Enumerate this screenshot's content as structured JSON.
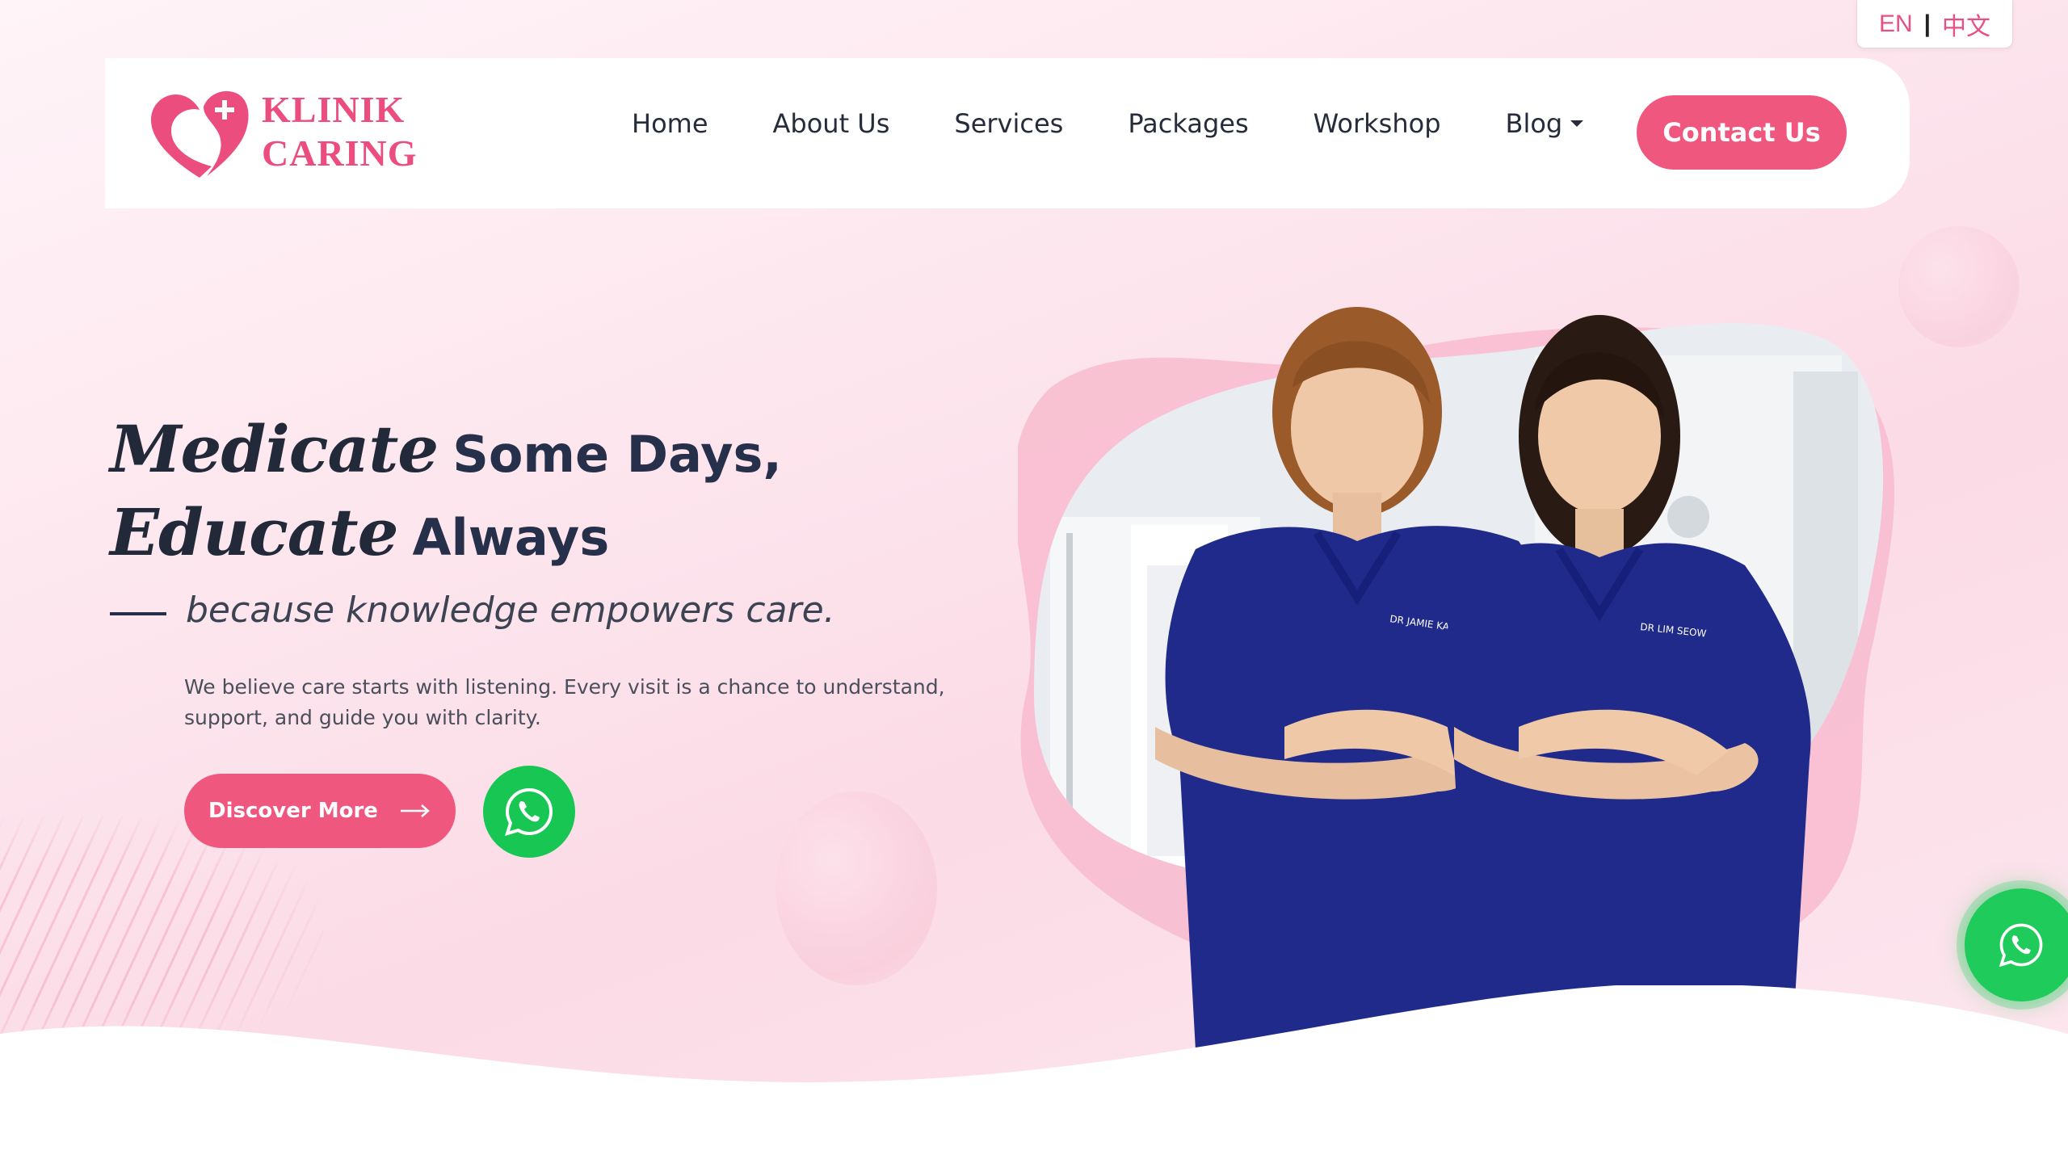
{
  "language": {
    "en": "EN",
    "separator": "|",
    "zh": "中文"
  },
  "brand": {
    "line1": "KLINIK",
    "line2": "CARING",
    "color": "#ec4d7f"
  },
  "nav": {
    "items": [
      {
        "label": "Home"
      },
      {
        "label": "About Us"
      },
      {
        "label": "Services"
      },
      {
        "label": "Packages"
      },
      {
        "label": "Workshop"
      },
      {
        "label": "Blog"
      }
    ],
    "contact_label": "Contact Us"
  },
  "hero": {
    "line1_script": "Medicate",
    "line1_plain": "Some Days,",
    "line2_script": "Educate",
    "line2_plain": "Always",
    "tagline": "because knowledge empowers care.",
    "description": "We believe care starts with listening. Every visit is a chance to understand, support, and guide you with clarity.",
    "discover_label": "Discover More"
  },
  "badges": {
    "left": "DR JAMIE KANG",
    "right": "DR LIM SEOW"
  },
  "colors": {
    "accent": "#f0577f",
    "whatsapp": "#1fcb5b",
    "scrubs": "#1f2a8a",
    "heading": "#27304a"
  },
  "icons": {
    "whatsapp": "whatsapp-icon",
    "arrow": "arrow-right-icon",
    "caret": "caret-down-icon"
  }
}
